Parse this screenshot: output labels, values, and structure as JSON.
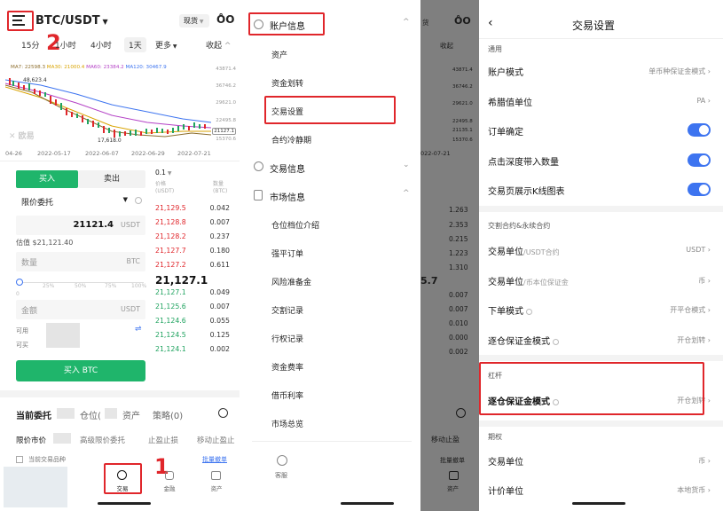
{
  "annotations": {
    "step1": "1",
    "step2": "2"
  },
  "trade": {
    "pair": "BTC/USDT",
    "spot_dropdown": "现货",
    "timeframes": [
      "15分",
      "1小时",
      "4小时",
      "1天",
      "更多"
    ],
    "collapse": "收起",
    "ma": {
      "ma7": "MA7: 22598.3",
      "ma30": "MA30: 21000.4",
      "ma60": "MA60: 23384.2",
      "ma120": "MA120: 30467.9"
    },
    "chart_high": "48,623.4",
    "chart_low": "17,618.0",
    "y_ticks": [
      "43871.4",
      "36746.2",
      "29621.0",
      "22495.8",
      "21127.1",
      "15370.6"
    ],
    "x_ticks": [
      "04-26",
      "2022-05-17",
      "2022-06-07",
      "2022-06-29",
      "2022-07-21"
    ],
    "buy_tab": "买入",
    "sell_tab": "卖出",
    "order_type": "限价委托",
    "price_value": "21121.4",
    "price_unit": "USDT",
    "estimate": "估值 $21,121.40",
    "qty_placeholder": "数量",
    "qty_unit": "BTC",
    "slider_ticks": [
      "0",
      "25%",
      "50%",
      "75%",
      "100%"
    ],
    "amount_placeholder": "金额",
    "amount_unit": "USDT",
    "available": "可用",
    "buyable": "可买",
    "buy_button": "买入 BTC",
    "ob_step": "0.1",
    "ob_col_price": "价格",
    "ob_col_price_unit": "(USDT)",
    "ob_col_qty": "数量",
    "ob_col_qty_unit": "(BTC)",
    "asks": [
      {
        "p": "21,129.5",
        "q": "0.042"
      },
      {
        "p": "21,128.8",
        "q": "0.007"
      },
      {
        "p": "21,128.2",
        "q": "0.237"
      },
      {
        "p": "21,127.7",
        "q": "0.180"
      },
      {
        "p": "21,127.2",
        "q": "0.611"
      }
    ],
    "last_price": "21,127.1",
    "bids": [
      {
        "p": "21,127.1",
        "q": "0.049"
      },
      {
        "p": "21,125.6",
        "q": "0.007"
      },
      {
        "p": "21,124.6",
        "q": "0.055"
      },
      {
        "p": "21,124.5",
        "q": "0.125"
      },
      {
        "p": "21,124.1",
        "q": "0.002"
      }
    ],
    "tabs1": [
      "当前委托",
      "仓位(",
      "资产",
      "策略(0)"
    ],
    "tabs2": [
      "限价市价",
      "高级限价委托",
      "止盈止损",
      "移动止盈止"
    ],
    "current_pair_only": "当前交易品种",
    "batch_cancel": "批量撤单",
    "nav": [
      "交易",
      "金融",
      "资产"
    ]
  },
  "menu": {
    "account_info": "账户信息",
    "account_items": [
      "资产",
      "资金划转",
      "交易设置",
      "合约冷静期"
    ],
    "trade_info": "交易信息",
    "market_info": "市场信息",
    "market_items": [
      "仓位档位介绍",
      "强平订单",
      "风险准备金",
      "交割记录",
      "行权记录",
      "资金费率",
      "借币利率",
      "市场总览"
    ],
    "support": "客服"
  },
  "behind": {
    "pair_frag": "货",
    "collapse": "收起",
    "y1": "43871.4",
    "y2": "36746.2",
    "y3": "29621.0",
    "y4": "22495.8",
    "y5": "21135.1",
    "y6": "15370.6",
    "xdate": "022-07-21",
    "n1": "1.263",
    "n2": "2.353",
    "n3": "0.215",
    "n4": "1.223",
    "n5": "1.310",
    "big": "5.7",
    "n6": "0.007",
    "n7": "0.007",
    "n8": "0.010",
    "n9": "0.000",
    "n10": "0.002",
    "tab_frag": "移动止盈",
    "batch": "批量撤单",
    "asset": "资产"
  },
  "settings": {
    "title": "交易设置",
    "sec_general": "通用",
    "account_mode": "账户模式",
    "account_mode_val": "单币种保证金模式",
    "greek_unit": "希腊值单位",
    "greek_unit_val": "PA",
    "order_confirm": "订单确定",
    "depth_qty": "点击深度带入数量",
    "show_kline": "交易页展示K线图表",
    "sec_futures": "交割合约&永续合约",
    "trade_unit": "交易单位",
    "trade_unit_hint1": "/USDT合约",
    "trade_unit_val1": "USDT",
    "trade_unit_hint2": "/币本位保证金",
    "trade_unit_val2": "币",
    "order_mode": "下单模式",
    "order_mode_val": "开平仓模式",
    "isolated_mode": "逐仓保证金模式",
    "isolated_mode_val": "开仓划转",
    "sec_leverage": "杠杆",
    "lev_isolated_mode": "逐仓保证金模式",
    "lev_isolated_val": "开仓划转",
    "sec_options": "期权",
    "opt_trade_unit": "交易单位",
    "opt_trade_unit_val": "币",
    "quote_unit": "计价单位",
    "quote_unit_val": "本地货币"
  },
  "colors": {
    "buy": "#1fb56b",
    "sell": "#e0262b",
    "toggle": "#3d74f0",
    "annotation": "#e0262b"
  }
}
